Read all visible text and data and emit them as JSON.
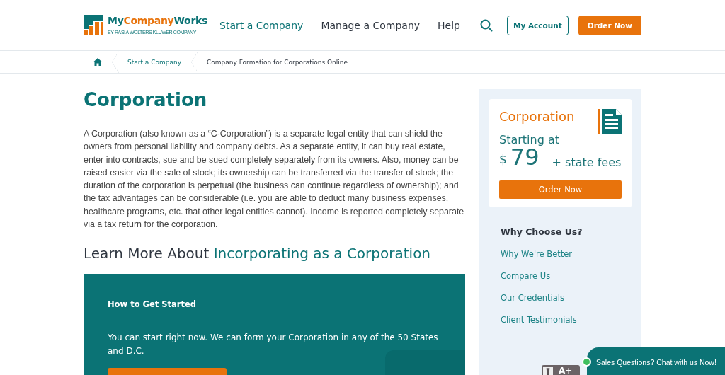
{
  "header": {
    "logo": {
      "name_parts": [
        "My",
        "Company",
        "Works"
      ],
      "tagline": "BY RASi A WOLTERS KLUWER COMPANY"
    },
    "nav": [
      {
        "label": "Start a Company",
        "selected": true
      },
      {
        "label": "Manage a Company",
        "selected": false
      },
      {
        "label": "Help",
        "selected": false
      }
    ],
    "account_button": "My Account",
    "order_button": "Order Now"
  },
  "breadcrumb": [
    "Start a Company",
    "Company Formation for Corporations Online"
  ],
  "main": {
    "title": "Corporation",
    "description": "A Corporation (also known as a “C-Corporation”) is a separate legal entity that can shield the owners from personal liability and company debts. As a separate entity, it can buy real estate, enter into contracts, sue and be sued completely separately from its owners. Also, money can be raised easier via the sale of stock; its ownership can be transferred via the transfer of stock; the duration of the corporation is perpetual (the business can continue regardless of ownership); and the tax advantages can be considerable (i.e. you are able to deduct many business expenses, healthcare programs, etc. that other legal entities cannot). Income is reported completely separate via a tax return for the corporation.",
    "learn_more": [
      "Learn More About ",
      "Incorporating as a Corporation"
    ],
    "panel": {
      "title": "How to Get Started",
      "text": "You can start right now. We can form your Corporation in any of the 50 States and D.C."
    }
  },
  "sidebar": {
    "price_card": {
      "title": "Corporation",
      "starting": "Starting at",
      "currency": "$",
      "price": "79",
      "suffix": "+ state fees",
      "button": "Order Now"
    },
    "why_title": "Why Choose Us?",
    "links": [
      "Why We're Better",
      "Compare Us",
      "Our Credentials",
      "Client Testimonials"
    ],
    "badge": "A+"
  },
  "chat": {
    "label": "Sales Questions? Chat with us Now!",
    "online": true
  }
}
